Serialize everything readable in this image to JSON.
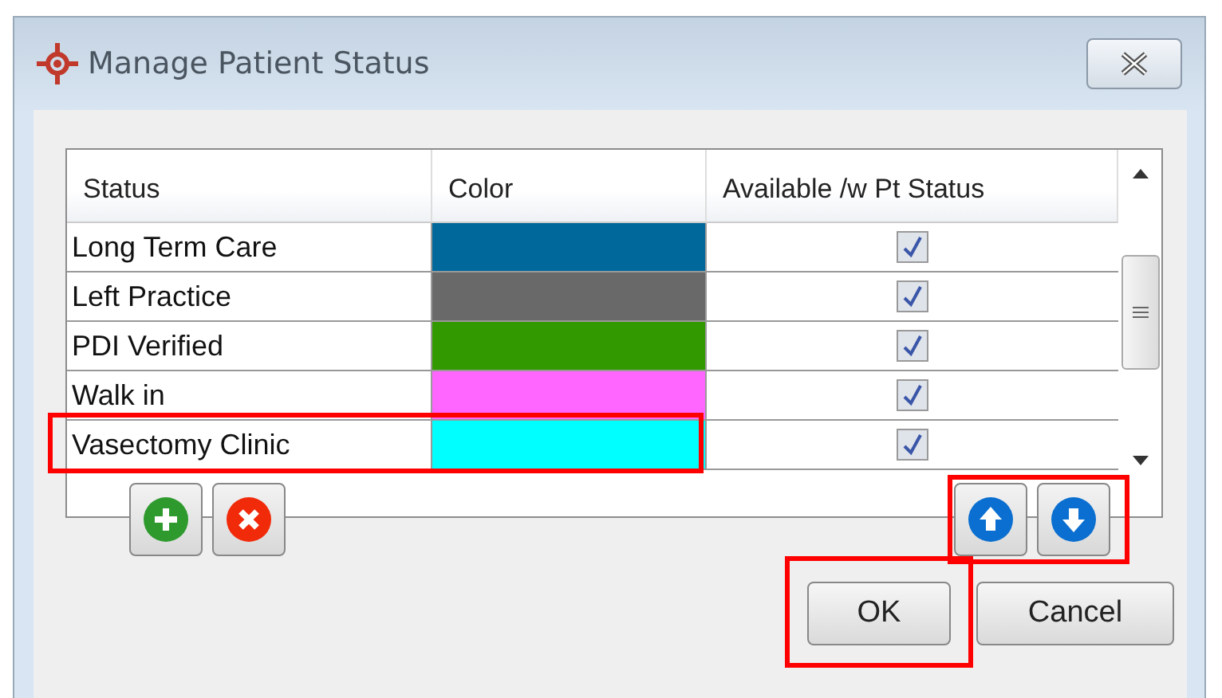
{
  "window": {
    "title": "Manage Patient Status"
  },
  "table": {
    "columns": [
      "Status",
      "Color",
      "Available /w Pt Status"
    ],
    "rows": [
      {
        "status": "Long Term Care",
        "color": "#00689a",
        "available": true,
        "highlighted": false
      },
      {
        "status": "Left Practice",
        "color": "#696969",
        "available": true,
        "highlighted": false
      },
      {
        "status": "PDI Verified",
        "color": "#339900",
        "available": true,
        "highlighted": false
      },
      {
        "status": "Walk in",
        "color": "#ff66ff",
        "available": true,
        "highlighted": false
      },
      {
        "status": "Vasectomy Clinic",
        "color": "#00ffff",
        "available": true,
        "highlighted": true
      }
    ]
  },
  "move_buttons": {
    "highlighted": true
  },
  "buttons": [
    {
      "label": "OK",
      "highlighted": true
    },
    {
      "label": "Cancel",
      "highlighted": false
    }
  ]
}
